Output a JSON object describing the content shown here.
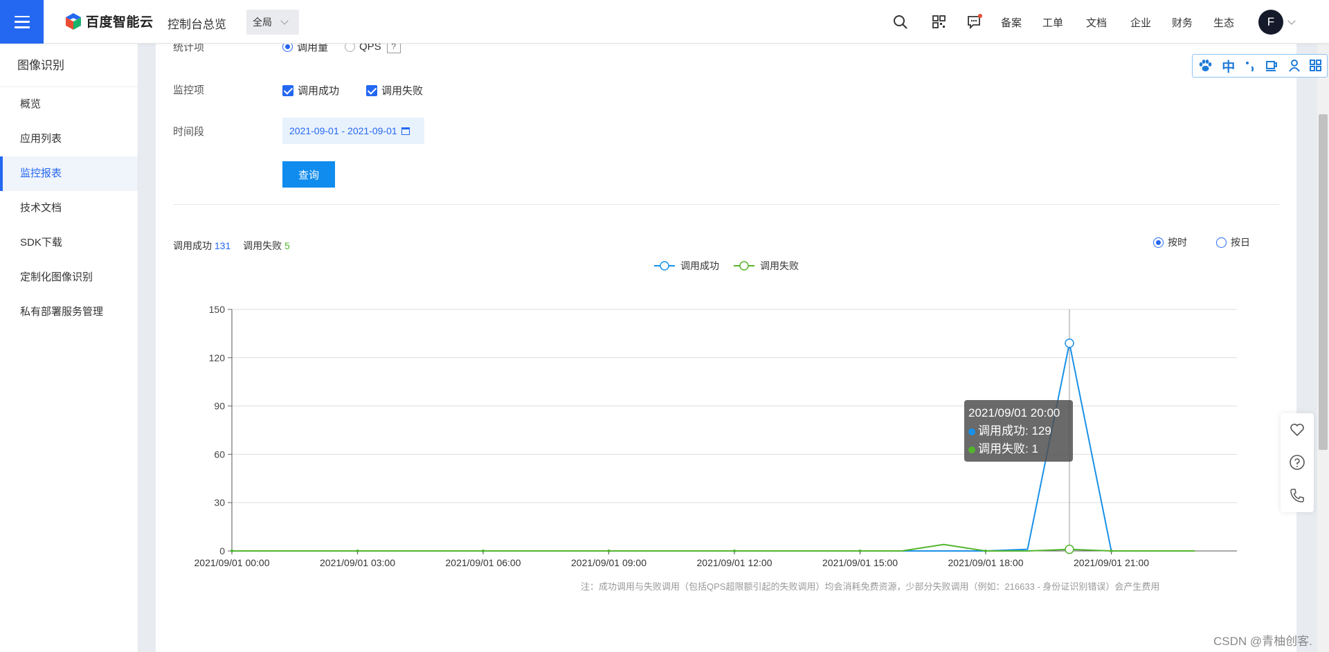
{
  "topbar": {
    "logo_text": "百度智能云",
    "console_title": "控制台总览",
    "region": "全局",
    "nav": [
      "备案",
      "工单",
      "文档",
      "企业",
      "财务",
      "生态"
    ],
    "avatar_letter": "F",
    "icons": [
      "search-icon",
      "qrcode-icon",
      "message-icon"
    ]
  },
  "sidebar": {
    "title": "图像识别",
    "items": [
      {
        "label": "概览"
      },
      {
        "label": "应用列表"
      },
      {
        "label": "监控报表"
      },
      {
        "label": "技术文档"
      },
      {
        "label": "SDK下载"
      },
      {
        "label": "定制化图像识别"
      },
      {
        "label": "私有部署服务管理"
      }
    ],
    "active_index": 2
  },
  "form": {
    "stat_label": "统计项",
    "stat_options": [
      "调用量",
      "QPS"
    ],
    "stat_help": "?",
    "monitor_label": "监控项",
    "monitor_options": [
      "调用成功",
      "调用失败"
    ],
    "period_label": "时间段",
    "period_value": "2021-09-01 - 2021-09-01",
    "query_button": "查询"
  },
  "summary": {
    "success_label": "调用成功",
    "success_count": "131",
    "fail_label": "调用失败",
    "fail_count": "5"
  },
  "granularity": {
    "options": [
      "按时",
      "按日"
    ],
    "selected": "按时"
  },
  "chart_data": {
    "type": "line",
    "title": "",
    "xlabel": "",
    "ylabel": "",
    "ylim": [
      0,
      150
    ],
    "yticks": [
      0,
      30,
      60,
      90,
      120,
      150
    ],
    "x_tick_labels": [
      "2021/09/01 00:00",
      "2021/09/01 03:00",
      "2021/09/01 06:00",
      "2021/09/01 09:00",
      "2021/09/01 12:00",
      "2021/09/01 15:00",
      "2021/09/01 18:00",
      "2021/09/01 21:00"
    ],
    "x": [
      "00:00",
      "01:00",
      "02:00",
      "03:00",
      "04:00",
      "05:00",
      "06:00",
      "07:00",
      "08:00",
      "09:00",
      "10:00",
      "11:00",
      "12:00",
      "13:00",
      "14:00",
      "15:00",
      "16:00",
      "17:00",
      "18:00",
      "19:00",
      "20:00",
      "21:00",
      "22:00",
      "23:00"
    ],
    "legend_position": "top-center",
    "grid": true,
    "series": [
      {
        "name": "调用成功",
        "color": "#1890e8",
        "values": [
          0,
          0,
          0,
          0,
          0,
          0,
          0,
          0,
          0,
          0,
          0,
          0,
          0,
          0,
          0,
          0,
          0,
          0,
          0,
          1,
          129,
          0,
          0,
          0
        ]
      },
      {
        "name": "调用失败",
        "color": "#53b52e",
        "values": [
          0,
          0,
          0,
          0,
          0,
          0,
          0,
          0,
          0,
          0,
          0,
          0,
          0,
          0,
          0,
          0,
          0,
          4,
          0,
          0,
          1,
          0,
          0,
          0
        ]
      }
    ]
  },
  "tooltip": {
    "time": "2021/09/01 20:00",
    "success_text": "调用成功: 129",
    "fail_text": "调用失败: 1"
  },
  "note": "注：成功调用与失败调用（包括QPS超限额引起的失败调用）均会消耗免费资源，少部分失败调用（例如：216633 - 身份证识别错误）会产生费用",
  "ime_bar": [
    "paw-icon",
    "中",
    "punctuation-icon",
    "cup-icon",
    "user-icon",
    "grid-icon"
  ],
  "float_tools": [
    "heart-icon",
    "help-icon",
    "phone-icon"
  ],
  "watermark": "CSDN @青柚创客."
}
